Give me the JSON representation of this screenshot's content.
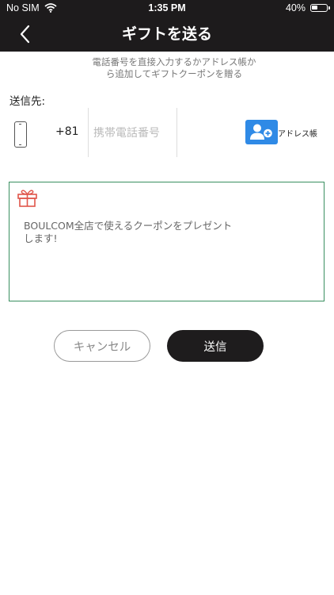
{
  "status_bar": {
    "carrier": "No SIM",
    "time": "1:35 PM",
    "battery": "40%",
    "battery_level": 0.4
  },
  "header": {
    "title": "ギフトを送る",
    "back_icon": "chevron-left-icon"
  },
  "description": {
    "line1": "電話番号を直接入力するかアドレス帳か",
    "line2": "ら追加してギフトクーポンを贈る"
  },
  "recipient": {
    "label": "送信先:",
    "country_code": "+81",
    "phone_placeholder": "携帯電話番号",
    "phone_value": "",
    "address_book_label": "アドレス帳"
  },
  "message": {
    "icon": "gift-icon",
    "line1": "BOULCOM全店で使えるクーポンをプレゼント",
    "line2": "します!"
  },
  "actions": {
    "cancel_label": "キャンセル",
    "send_label": "送信"
  },
  "colors": {
    "header_bg": "#1d1b1c",
    "accent_blue": "#2f8ae6",
    "border_green": "#3a8f60",
    "gift_red": "#e0554a"
  }
}
